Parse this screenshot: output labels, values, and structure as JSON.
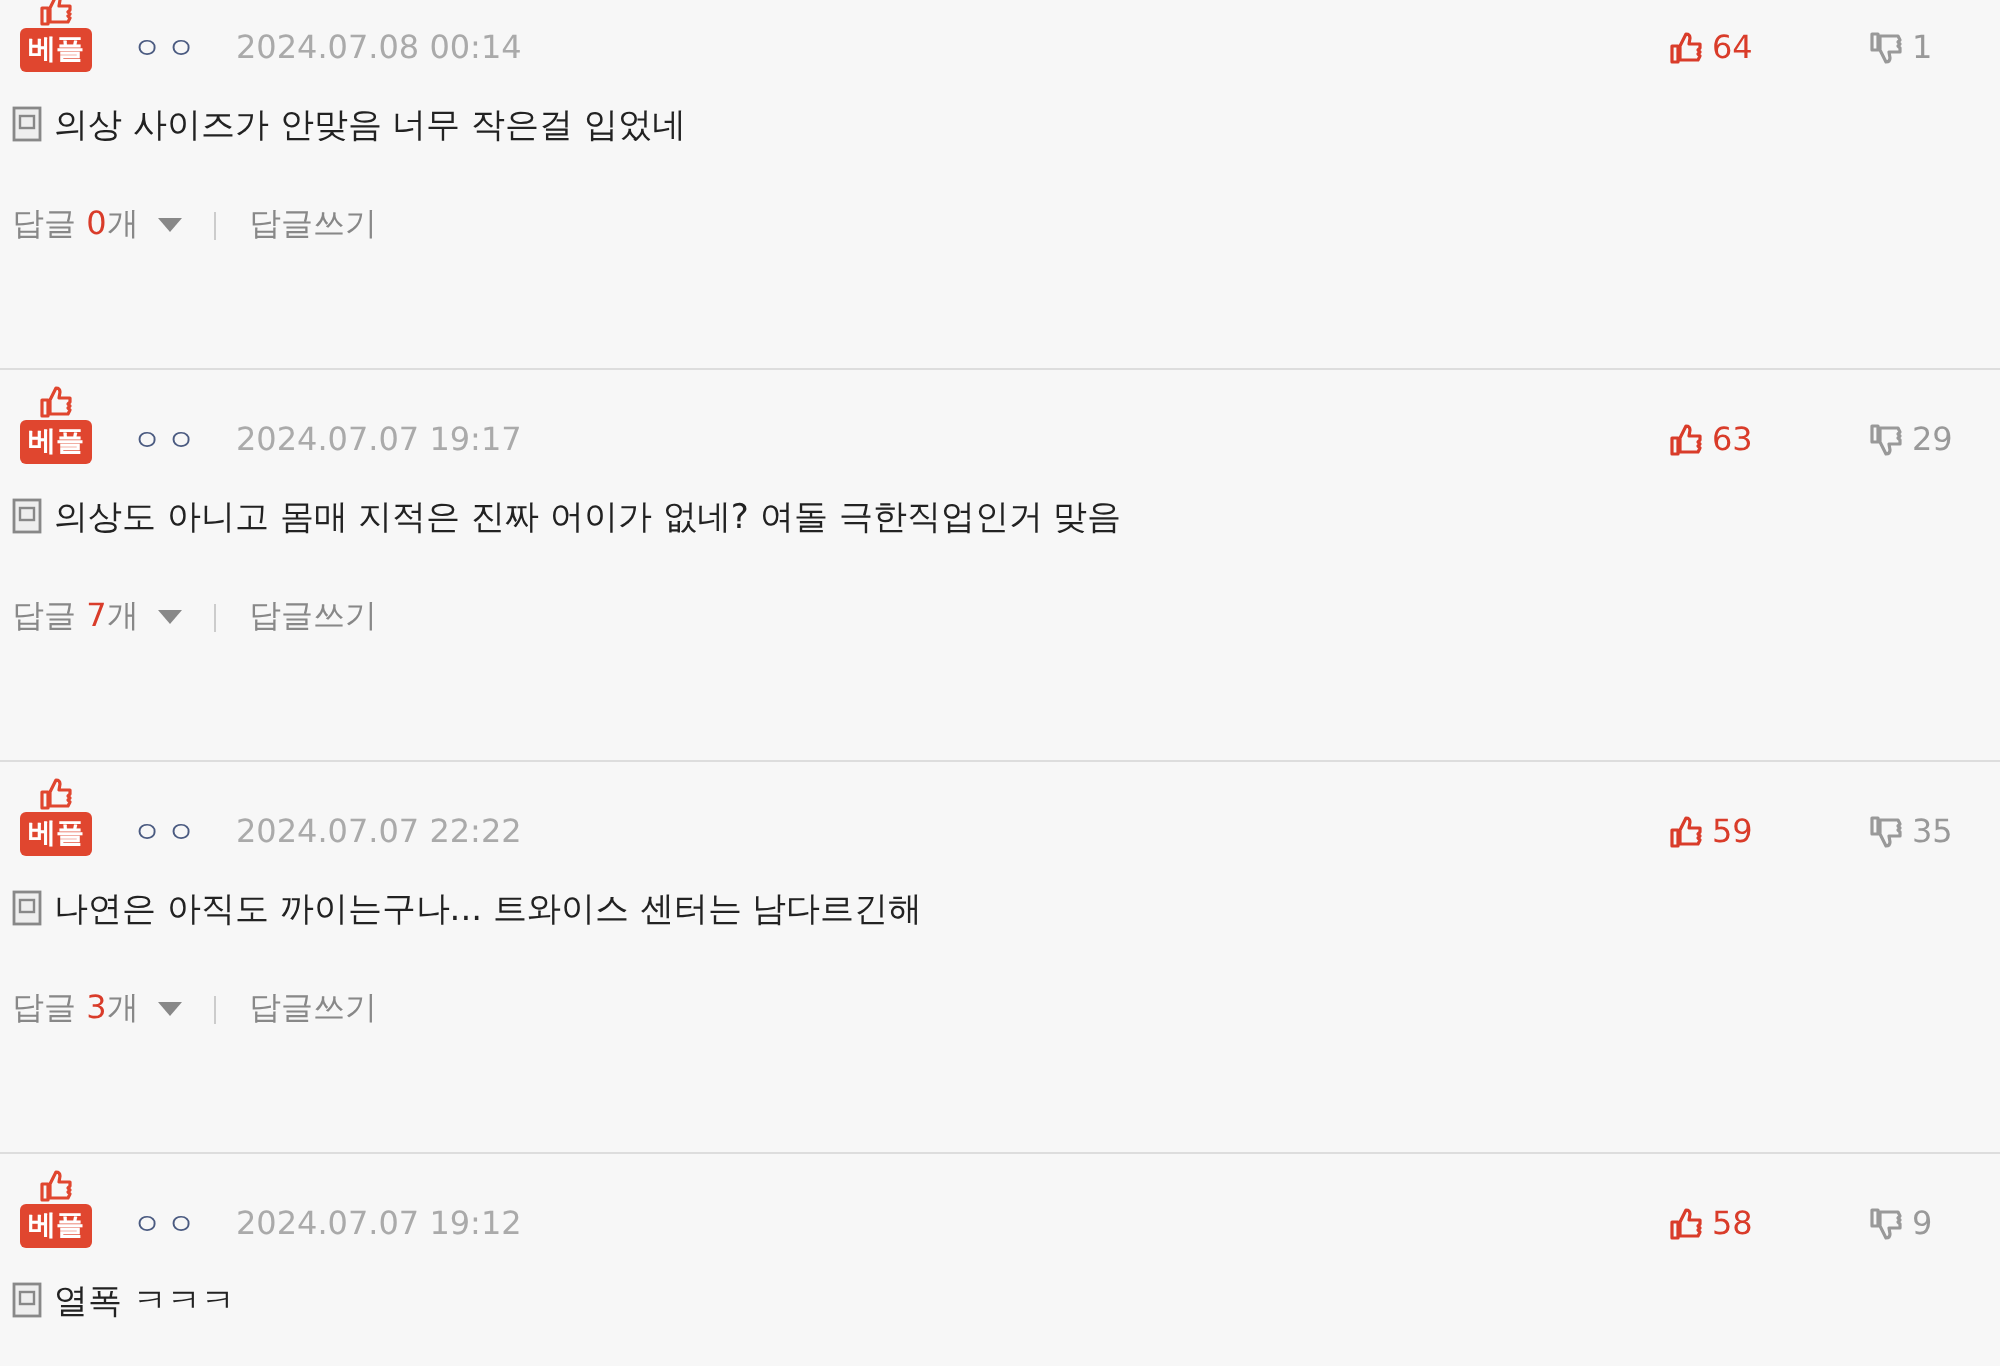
{
  "comments": [
    {
      "badge": "베플",
      "author": "ㅇㅇ",
      "date": "2024.07.08 00:14",
      "likes": "64",
      "dislikes": "1",
      "text": "의상 사이즈가 안맞음 너무 작은걸 입었네",
      "reply_label": "답글",
      "reply_count": "0",
      "reply_unit": "개",
      "write_reply": "답글쓰기"
    },
    {
      "badge": "베플",
      "author": "ㅇㅇ",
      "date": "2024.07.07 19:17",
      "likes": "63",
      "dislikes": "29",
      "text": "의상도 아니고 몸매 지적은 진짜 어이가 없네? 여돌 극한직업인거 맞음",
      "reply_label": "답글",
      "reply_count": "7",
      "reply_unit": "개",
      "write_reply": "답글쓰기"
    },
    {
      "badge": "베플",
      "author": "ㅇㅇ",
      "date": "2024.07.07 22:22",
      "likes": "59",
      "dislikes": "35",
      "text": "나연은 아직도 까이는구나... 트와이스 센터는 남다르긴해",
      "reply_label": "답글",
      "reply_count": "3",
      "reply_unit": "개",
      "write_reply": "답글쓰기"
    },
    {
      "badge": "베플",
      "author": "ㅇㅇ",
      "date": "2024.07.07 19:12",
      "likes": "58",
      "dislikes": "9",
      "text": "열폭 ㅋㅋㅋ"
    }
  ]
}
